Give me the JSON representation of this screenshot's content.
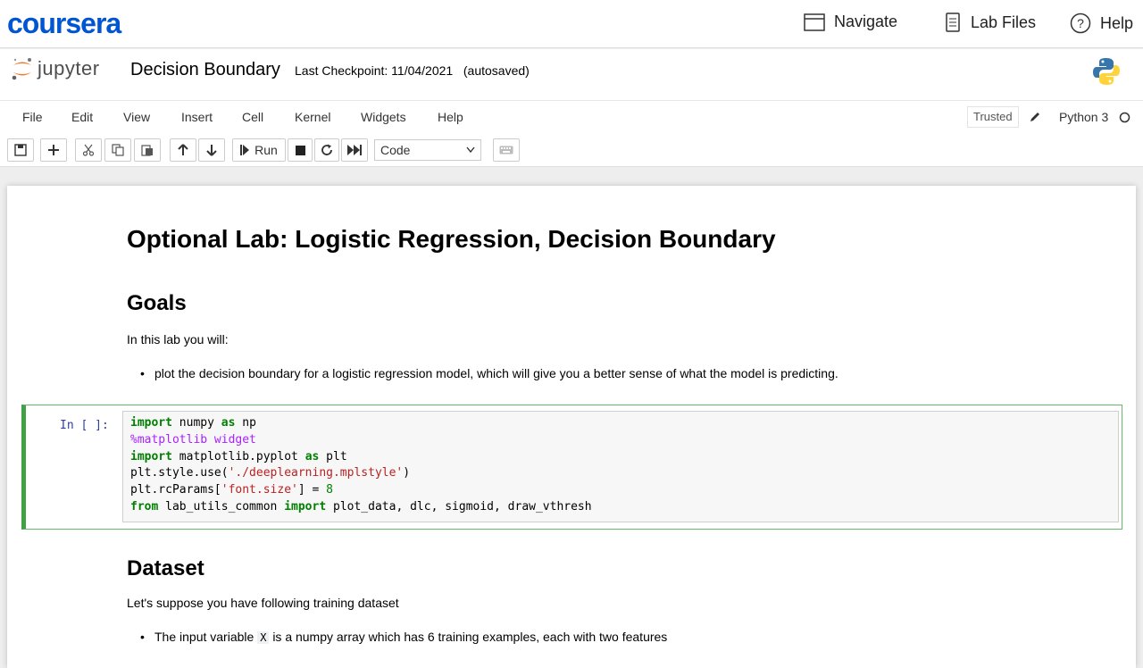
{
  "coursera": {
    "logo": "coursera",
    "nav": [
      {
        "label": "Navigate",
        "icon": "window-icon"
      },
      {
        "label": "Lab Files",
        "icon": "document-icon"
      },
      {
        "label": "Help",
        "icon": "help-icon"
      }
    ]
  },
  "jupyter": {
    "logo_text": "jupyter",
    "notebook_name": "Decision Boundary",
    "checkpoint": "Last Checkpoint: 11/04/2021",
    "autosave": "(autosaved)"
  },
  "menu": {
    "items": [
      "File",
      "Edit",
      "View",
      "Insert",
      "Cell",
      "Kernel",
      "Widgets",
      "Help"
    ],
    "trusted": "Trusted",
    "kernel": "Python 3"
  },
  "toolbar": {
    "run_label": "Run",
    "cell_type": "Code"
  },
  "notebook": {
    "title": "Optional Lab: Logistic Regression, Decision Boundary",
    "goals_heading": "Goals",
    "goals_intro": "In this lab you will:",
    "goals_bullet": "plot the decision boundary for a logistic regression model, which will give you a better sense of what the model is predicting.",
    "cell_prompt": "In [ ]:",
    "code": {
      "l1_kw": "import",
      "l1_mod": " numpy ",
      "l1_as": "as",
      "l1_alias": " np",
      "l2": "%matplotlib widget",
      "l3_kw": "import",
      "l3_mod": " matplotlib.pyplot ",
      "l3_as": "as",
      "l3_alias": " plt",
      "l4_a": "plt.style.use(",
      "l4_str": "'./deeplearning.mplstyle'",
      "l4_b": ")",
      "l5_a": "plt.rcParams[",
      "l5_str": "'font.size'",
      "l5_b": "] = ",
      "l5_num": "8",
      "l6_from": "from",
      "l6_mod": " lab_utils_common ",
      "l6_import": "import",
      "l6_rest": " plot_data, dlc, sigmoid, draw_vthresh"
    },
    "dataset_heading": "Dataset",
    "dataset_intro": "Let's suppose you have following training dataset",
    "dataset_bullet_a": "The input variable",
    "dataset_bullet_code": "X",
    "dataset_bullet_b": "is a numpy array which has 6 training examples, each with two features"
  }
}
